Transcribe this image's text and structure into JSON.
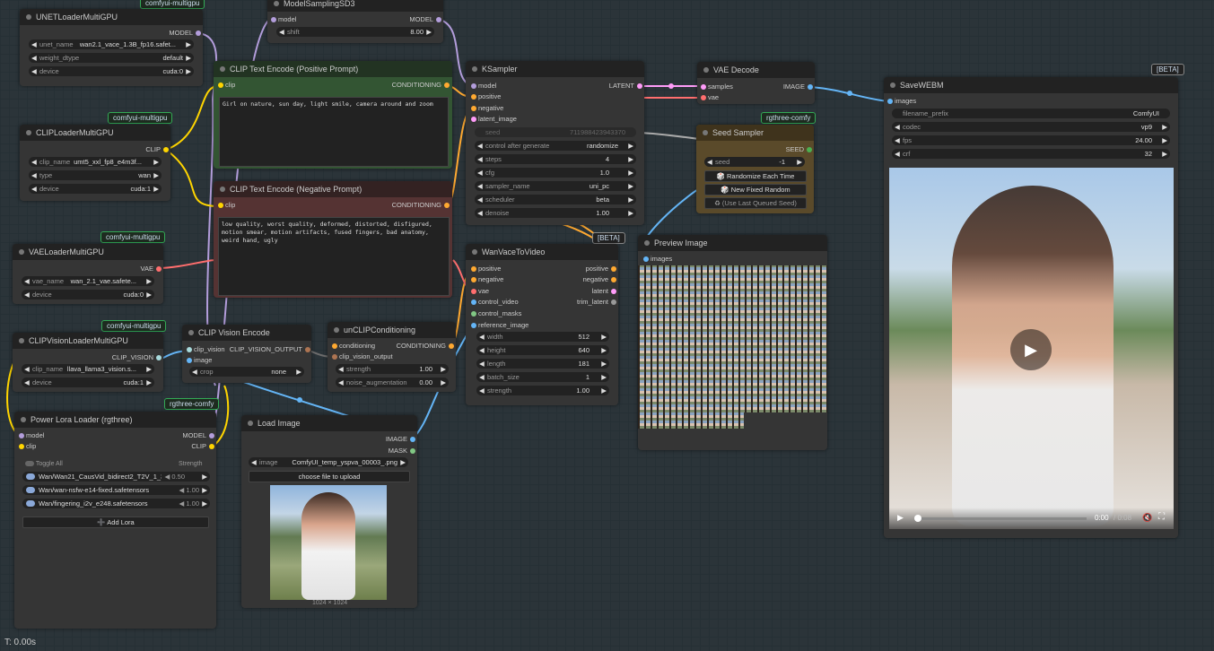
{
  "statusbar": {
    "time": "T: 0.00s"
  },
  "colors": {
    "clip_slot": "#ffd500",
    "model_slot": "#b39ddb",
    "vae_slot": "#ff6e6e",
    "latent_slot": "#ff9cf9",
    "image_slot": "#64b5f6",
    "cond_slot": "#ffa931"
  },
  "badges": {
    "multigpu": "comfyui-multigpu",
    "rgthree": "rgthree-comfy",
    "beta": "[BETA]"
  },
  "unet": {
    "title": "UNETLoaderMultiGPU",
    "out": "MODEL",
    "w1n": "unet_name",
    "w1v": "wan2.1_vace_1.3B_fp16.safet...",
    "w2n": "weight_dtype",
    "w2v": "default",
    "w3n": "device",
    "w3v": "cuda:0"
  },
  "msd3": {
    "title": "ModelSamplingSD3",
    "in": "model",
    "out": "MODEL",
    "wn": "shift",
    "wv": "8.00"
  },
  "clipload": {
    "title": "CLIPLoaderMultiGPU",
    "out": "CLIP",
    "w1n": "clip_name",
    "w1v": "umt5_xxl_fp8_e4m3f...",
    "w2n": "type",
    "w2v": "wan",
    "w3n": "device",
    "w3v": "cuda:1"
  },
  "pos": {
    "title": "CLIP Text Encode (Positive Prompt)",
    "in": "clip",
    "out": "CONDITIONING",
    "text": "Girl on nature, sun day, light smile, camera around and zoom"
  },
  "neg": {
    "title": "CLIP Text Encode (Negative Prompt)",
    "in": "clip",
    "out": "CONDITIONING",
    "text": "low quality, worst quality, deformed, distorted, disfigured, motion smear, motion artifacts, fused fingers, bad anatomy, weird hand, ugly"
  },
  "ks": {
    "title": "KSampler",
    "i1": "model",
    "i2": "positive",
    "i3": "negative",
    "i4": "latent_image",
    "i5": "seed",
    "out": "LATENT",
    "seedv": "711988423943370",
    "w1n": "control after generate",
    "w1v": "randomize",
    "w2n": "steps",
    "w2v": "4",
    "w3n": "cfg",
    "w3v": "1.0",
    "w4n": "sampler_name",
    "w4v": "uni_pc",
    "w5n": "scheduler",
    "w5v": "beta",
    "w6n": "denoise",
    "w6v": "1.00"
  },
  "vaed": {
    "title": "VAE Decode",
    "i1": "samples",
    "i2": "vae",
    "out": "IMAGE"
  },
  "seed": {
    "title": "Seed Sampler",
    "out": "SEED",
    "wn": "seed",
    "wv": "-1",
    "b1": "Randomize Each Time",
    "b2": "New Fixed Random",
    "b3": "(Use Last Queued Seed)"
  },
  "save": {
    "title": "SaveWEBM",
    "in": "images",
    "w1n": "filename_prefix",
    "w1v": "ComfyUI",
    "w2n": "codec",
    "w2v": "vp9",
    "w3n": "fps",
    "w3v": "24.00",
    "w4n": "crf",
    "w4v": "32",
    "time": "0:00",
    "dur": "/ 0:08"
  },
  "vael": {
    "title": "VAELoaderMultiGPU",
    "out": "VAE",
    "w1n": "vae_name",
    "w1v": "wan_2.1_vae.safete...",
    "w2n": "device",
    "w2v": "cuda:0"
  },
  "wan": {
    "title": "WanVaceToVideo",
    "i1": "positive",
    "i2": "negative",
    "i3": "vae",
    "i4": "control_video",
    "i5": "control_masks",
    "i6": "reference_image",
    "o1": "positive",
    "o2": "negative",
    "o3": "latent",
    "o4": "trim_latent",
    "w1n": "width",
    "w1v": "512",
    "w2n": "height",
    "w2v": "640",
    "w3n": "length",
    "w3v": "181",
    "w4n": "batch_size",
    "w4v": "1",
    "w5n": "strength",
    "w5v": "1.00"
  },
  "prev": {
    "title": "Preview Image",
    "in": "images"
  },
  "cvl": {
    "title": "CLIPVisionLoaderMultiGPU",
    "out": "CLIP_VISION",
    "w1n": "clip_name",
    "w1v": "llava_llama3_vision.s...",
    "w2n": "device",
    "w2v": "cuda:1"
  },
  "cve": {
    "title": "CLIP Vision Encode",
    "i1": "clip_vision",
    "i2": "image",
    "out": "CLIP_VISION_OUTPUT",
    "wn": "crop",
    "wv": "none"
  },
  "unclip": {
    "title": "unCLIPConditioning",
    "i1": "conditioning",
    "i2": "clip_vision_output",
    "out": "CONDITIONING",
    "w1n": "strength",
    "w1v": "1.00",
    "w2n": "noise_augmentation",
    "w2v": "0.00"
  },
  "lora": {
    "title": "Power Lora Loader (rgthree)",
    "i1": "model",
    "i2": "clip",
    "o1": "MODEL",
    "o2": "CLIP",
    "toggle": "Toggle All",
    "strength": "Strength",
    "l1": "Wan/Wan21_CausVid_bidirect2_T2V_1_3...",
    "l1v": "0.50",
    "l2": "Wan/wan-nsfw-e14-fixed.safetensors",
    "l2v": "1.00",
    "l3": "Wan/fingering_i2v_e248.safetensors",
    "l3v": "1.00",
    "add": "Add Lora"
  },
  "load": {
    "title": "Load Image",
    "o1": "IMAGE",
    "o2": "MASK",
    "wn": "image",
    "wv": "ComfyUI_temp_yspva_00003_.png",
    "btn": "choose file to upload",
    "dims": "1024 × 1024"
  }
}
